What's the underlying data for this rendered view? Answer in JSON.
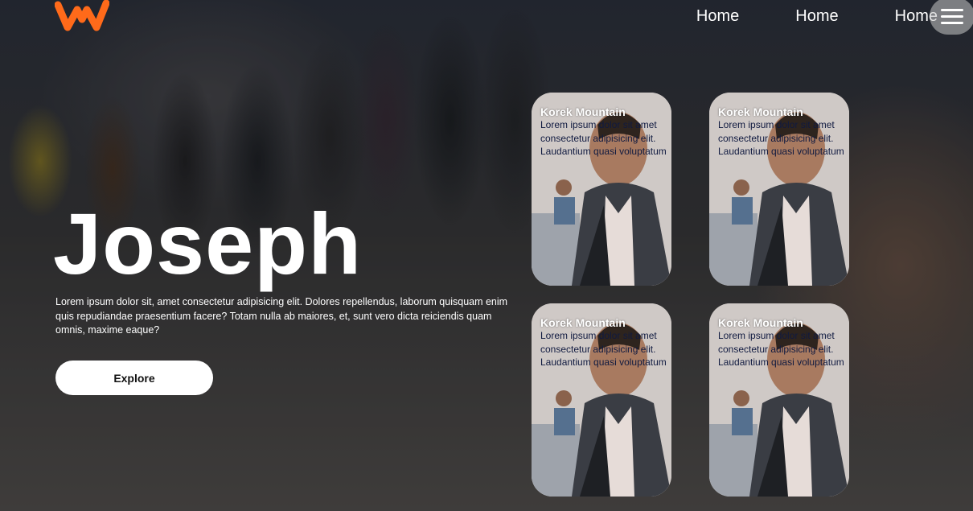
{
  "brand": {
    "logo_icon": "w-logo-icon",
    "logo_color": "#ff6a1a"
  },
  "nav": {
    "links": [
      "Home",
      "Home",
      "Home"
    ],
    "menu_icon": "hamburger-icon"
  },
  "hero": {
    "title": "Joseph",
    "text": "Lorem ipsum dolor sit, amet consectetur adipisicing elit. Dolores repellendus, laborum quisquam enim quis repudiandae praesentium facere? Totam nulla ab maiores, et, sunt vero dicta reiciendis quam omnis, maxime eaque?",
    "button_label": "Explore"
  },
  "cards": [
    {
      "title": "Korek Mountain",
      "text": "Lorem ipsum dolor sit amet consectetur adipisicing elit. Laudantium quasi voluptatum"
    },
    {
      "title": "Korek Mountain",
      "text": "Lorem ipsum dolor sit amet consectetur adipisicing elit. Laudantium quasi voluptatum"
    },
    {
      "title": "Korek Mountain",
      "text": "Lorem ipsum dolor sit amet consectetur adipisicing elit. Laudantium quasi voluptatum"
    },
    {
      "title": "Korek Mountain",
      "text": "Lorem ipsum dolor sit amet consectetur adipisicing elit. Laudantium quasi voluptatum"
    }
  ]
}
